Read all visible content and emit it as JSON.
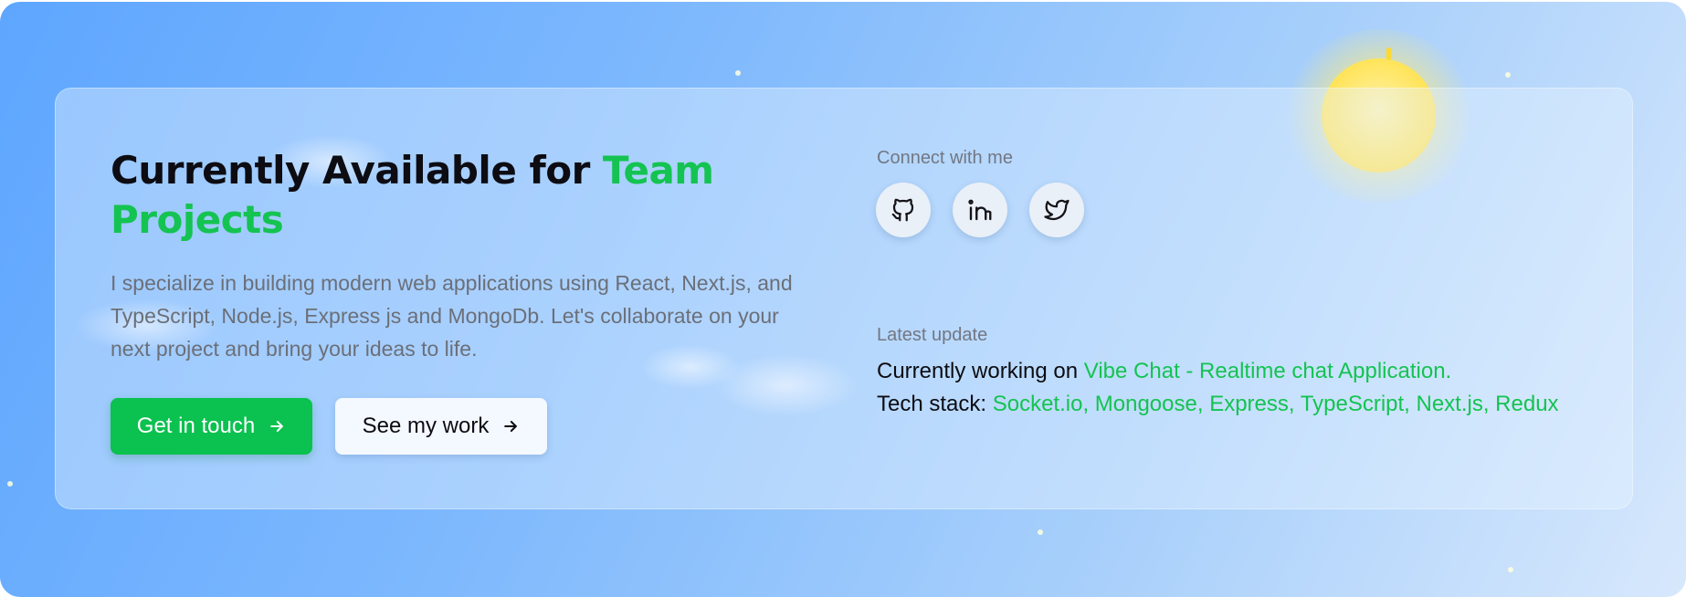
{
  "colors": {
    "accent_green": "#14c351",
    "button_green": "#0bc14f",
    "sky_light": "#d7e8fc",
    "sky_dark": "#5ea6ff",
    "sun": "#ffe45a"
  },
  "hero": {
    "title_prefix": "Currently Available for ",
    "title_highlight": "Team Projects",
    "description": "I specialize in building modern web applications using React, Next.js, and TypeScript, Node.js, Express js and MongoDb. Let's collaborate on your next project and bring your ideas to life."
  },
  "actions": {
    "primary_label": "Get in touch",
    "primary_icon": "arrow-right-icon",
    "secondary_label": "See my work",
    "secondary_icon": "arrow-right-icon"
  },
  "connect": {
    "label": "Connect with me",
    "links": [
      {
        "icon": "github-icon"
      },
      {
        "icon": "linkedin-icon"
      },
      {
        "icon": "twitter-icon"
      }
    ]
  },
  "update": {
    "label": "Latest update",
    "working_prefix": "Currently working on ",
    "project": "Vibe Chat - Realtime chat Application.",
    "stack_prefix": "Tech stack: ",
    "stack": "Socket.io, Mongoose, Express, TypeScript, Next.js, Redux"
  }
}
